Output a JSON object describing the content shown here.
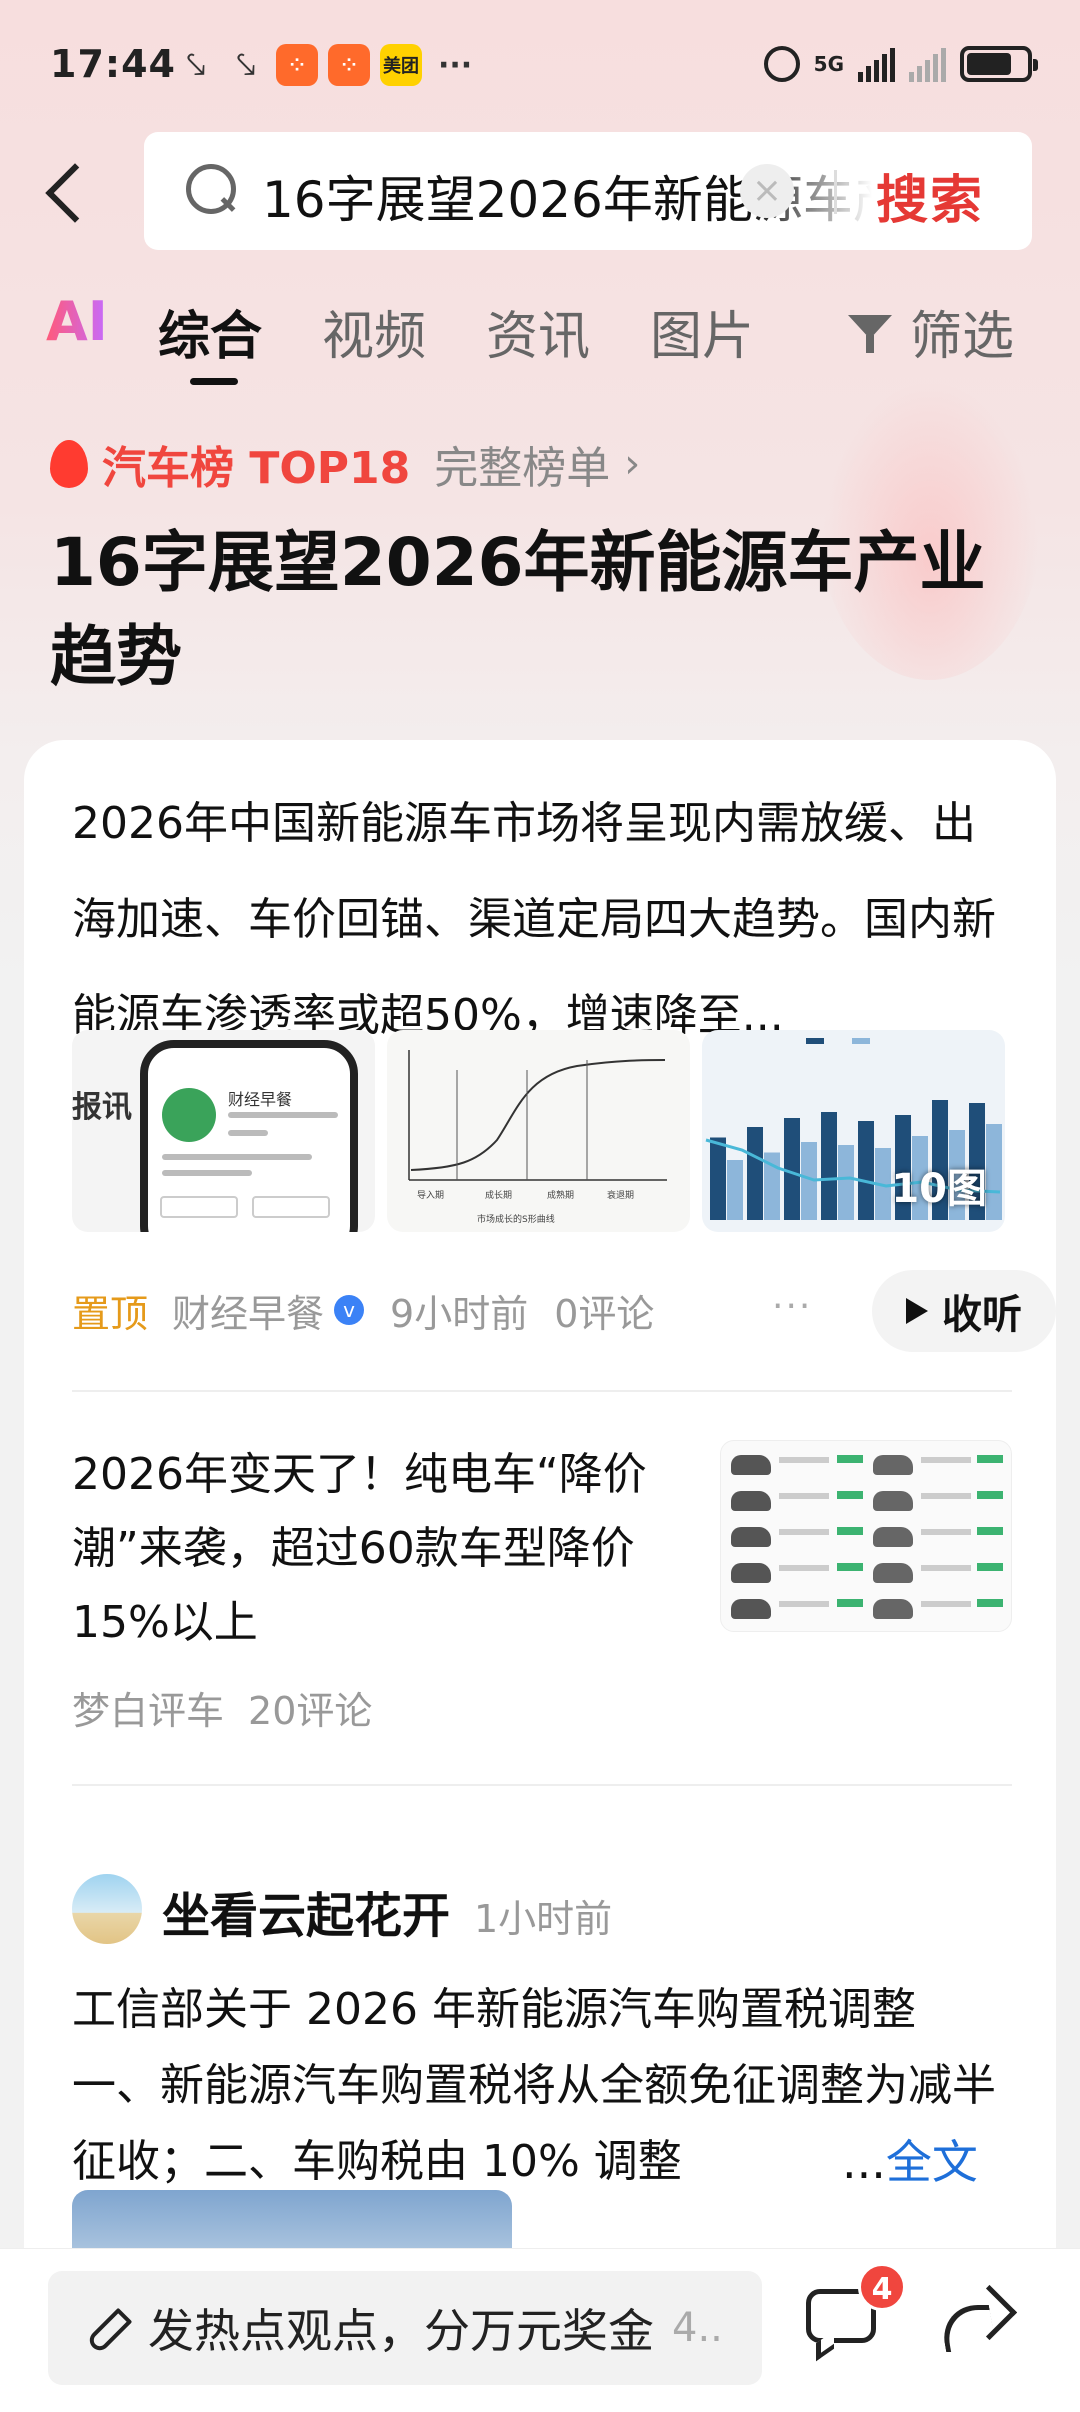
{
  "status_bar": {
    "time": "17:44",
    "app_badges": [
      "美团"
    ],
    "more": "···",
    "network": "5G"
  },
  "search": {
    "query": "16字展望2026年新能源车产业趋势",
    "button_label": "搜索"
  },
  "tabs": {
    "ai": "AI",
    "items": [
      "综合",
      "视频",
      "资讯",
      "图片"
    ],
    "active": "综合",
    "filter_label": "筛选"
  },
  "topic": {
    "rank_label": "汽车榜 TOP18",
    "rank_more": "完整榜单",
    "title": "16字展望2026年新能源车产业趋势"
  },
  "articles": [
    {
      "text": "2026年中国新能源车市场将呈现内需放缓、出海加速、车价回锚、渠道定局四大趋势。国内新能源车渗透率或超50%，增速降至...",
      "image_count_label": "10图",
      "thumb1_side_text": "报讯",
      "thumb1_account": "财经早餐",
      "thumb2_stages": [
        "导入期",
        "成长期",
        "成熟期",
        "衰退期"
      ],
      "thumb2_caption": "市场成长的S形曲线",
      "pinned_label": "置顶",
      "source": "财经早餐",
      "verified_icon": "v-verified-icon",
      "time": "9小时前",
      "comments": "0评论",
      "more": "···",
      "listen_label": "收听"
    },
    {
      "title": "2026年变天了！纯电车“降价潮”来袭，超过60款车型降价15%以上",
      "source": "梦白评车",
      "comments": "20评论"
    },
    {
      "author": "坐看云起花开",
      "time": "1小时前",
      "text": "工信部关于 2026 年新能源汽车购置税调整\n一、新能源汽车购置税将从全额免征调整为减半征收；二、车购税由 10% 调整",
      "more_prefix": "...",
      "full_text_label": "全文"
    }
  ],
  "bottom_bar": {
    "compose_placeholder": "发热点观点，分万元奖金",
    "compose_more": "4..",
    "comment_badge": "4"
  },
  "colors": {
    "accent_red": "#e53935",
    "rank_red": "#f0463e",
    "link_blue": "#1e6fd9",
    "pin_orange": "#e59a1a",
    "chart_dark": "#1f4e79",
    "chart_light": "#8db6da"
  }
}
